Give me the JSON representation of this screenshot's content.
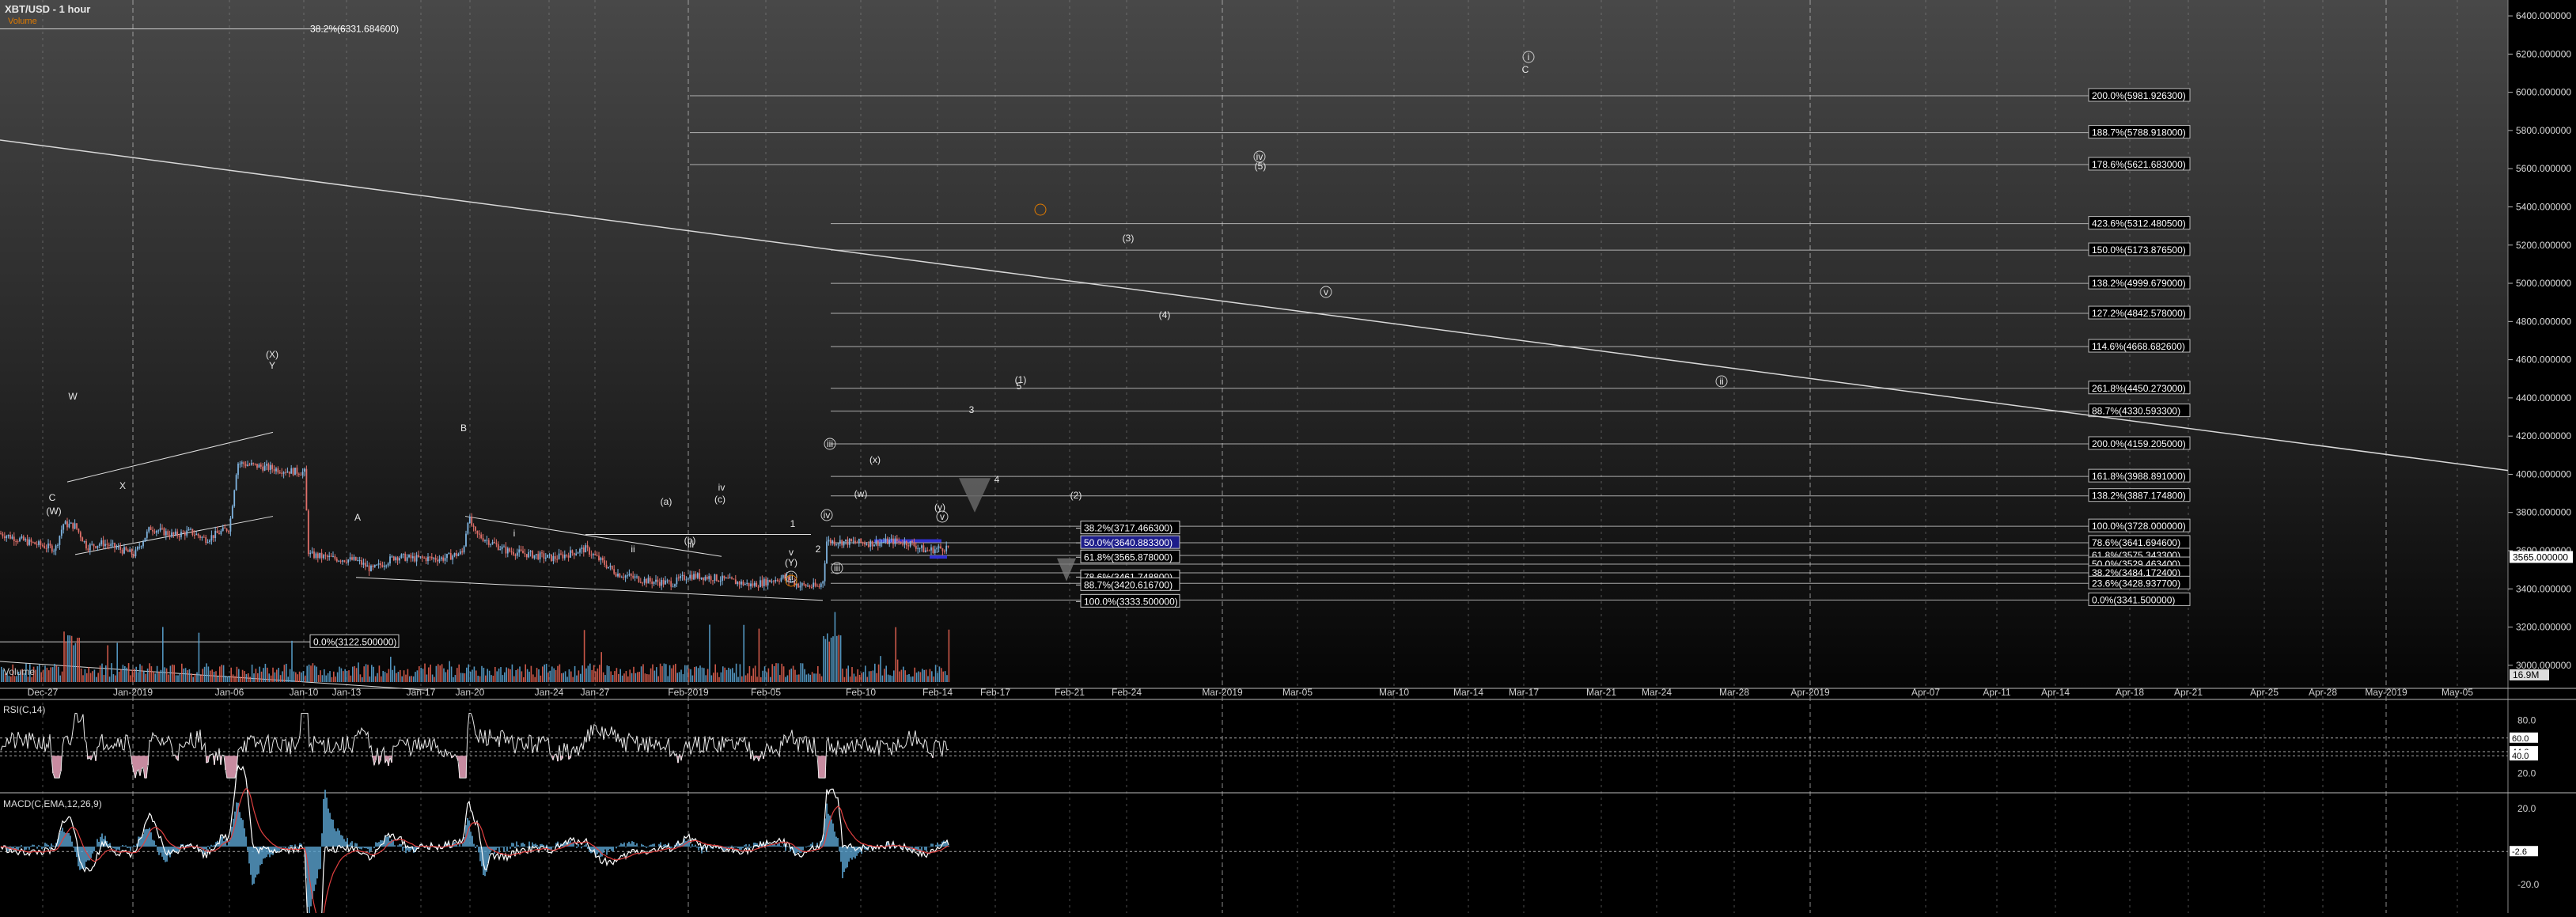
{
  "header": {
    "title": "XBT/USD - 1 hour",
    "volume_label": "Volume",
    "rsi_label": "RSI(C,14)",
    "macd_label": "MACD(C,EMA,12,26,9)",
    "volume_name": "Volume"
  },
  "colors": {
    "background": "#000000",
    "grid": "#cfcfcf",
    "candle_up": "#7fb4e0",
    "candle_down": "#e0706a",
    "fib_line": "#ffffff",
    "macd_line": "#ffffff",
    "macd_signal": "#e04040",
    "macd_hist": "#5aa3d0",
    "rsi_hist": "#c78ba0",
    "volume_up": "#5aa3d0",
    "volume_down": "#e06050",
    "orange": "#e07b00",
    "blue_box": "#3030d0"
  },
  "chart_data": {
    "type": "line",
    "title": "XBT/USD - 1 hour",
    "x_ticks": [
      "Dec-27",
      "Jan-2019",
      "Jan-06",
      "Jan-10",
      "Jan-13",
      "Jan-17",
      "Jan-20",
      "Jan-24",
      "Jan-27",
      "Feb-2019",
      "Feb-05",
      "Feb-10",
      "Feb-14",
      "Feb-17",
      "Feb-21",
      "Feb-24",
      "Mar-2019",
      "Mar-05",
      "Mar-10",
      "Mar-14",
      "Mar-17",
      "Mar-21",
      "Mar-24",
      "Mar-28",
      "Apr-2019",
      "Apr-07",
      "Apr-11",
      "Apr-14",
      "Apr-18",
      "Apr-21",
      "Apr-25",
      "Apr-28",
      "May-2019",
      "May-05"
    ],
    "y_ticks": [
      "6400.000000",
      "6200.000000",
      "6000.000000",
      "5800.000000",
      "5600.000000",
      "5400.000000",
      "5200.000000",
      "5000.000000",
      "4800.000000",
      "4600.000000",
      "4400.000000",
      "4200.000000",
      "4000.000000",
      "3800.000000",
      "3600.000000",
      "3400.000000",
      "3200.000000",
      "3000.000000"
    ],
    "y_range": [
      2900,
      6450
    ],
    "last_price_tag": "3565.000000",
    "volume_tag": "16.9M",
    "price_path": [
      [
        0,
        3690
      ],
      [
        40,
        3640
      ],
      [
        70,
        3610
      ],
      [
        80,
        3740
      ],
      [
        95,
        3730
      ],
      [
        110,
        3620
      ],
      [
        130,
        3640
      ],
      [
        170,
        3580
      ],
      [
        190,
        3720
      ],
      [
        220,
        3680
      ],
      [
        240,
        3700
      ],
      [
        260,
        3660
      ],
      [
        290,
        3720
      ],
      [
        300,
        4060
      ],
      [
        330,
        4040
      ],
      [
        360,
        4020
      ],
      [
        385,
        4010
      ],
      [
        390,
        3580
      ],
      [
        420,
        3560
      ],
      [
        450,
        3550
      ],
      [
        470,
        3500
      ],
      [
        500,
        3570
      ],
      [
        520,
        3560
      ],
      [
        560,
        3560
      ],
      [
        585,
        3590
      ],
      [
        592,
        3780
      ],
      [
        600,
        3690
      ],
      [
        640,
        3600
      ],
      [
        700,
        3560
      ],
      [
        740,
        3610
      ],
      [
        780,
        3480
      ],
      [
        820,
        3440
      ],
      [
        850,
        3430
      ],
      [
        870,
        3470
      ],
      [
        900,
        3460
      ],
      [
        950,
        3420
      ],
      [
        990,
        3460
      ],
      [
        1010,
        3420
      ],
      [
        1035,
        3410
      ],
      [
        1040,
        3440
      ],
      [
        1045,
        3650
      ],
      [
        1100,
        3640
      ],
      [
        1130,
        3650
      ],
      [
        1150,
        3640
      ],
      [
        1170,
        3600
      ],
      [
        1200,
        3620
      ]
    ],
    "fib_levels": [
      {
        "label": "38.2%(6331.684600)",
        "value": 6331.6846
      },
      {
        "label": "200.0%(5981.926300)",
        "value": 5981.9263
      },
      {
        "label": "188.7%(5788.918000)",
        "value": 5788.918
      },
      {
        "label": "178.6%(5621.683000)",
        "value": 5621.683
      },
      {
        "label": "423.6%(5312.480500)",
        "value": 5312.4805
      },
      {
        "label": "150.0%(5173.876500)",
        "value": 5173.8765
      },
      {
        "label": "138.2%(4999.679000)",
        "value": 4999.679
      },
      {
        "label": "127.2%(4842.578000)",
        "value": 4842.578
      },
      {
        "label": "114.6%(4668.682600)",
        "value": 4668.6826
      },
      {
        "label": "261.8%(4450.273000)",
        "value": 4450.273
      },
      {
        "label": "88.7%(4330.593300)",
        "value": 4330.5933
      },
      {
        "label": "200.0%(4159.205000)",
        "value": 4159.205
      },
      {
        "label": "161.8%(3988.891000)",
        "value": 3988.891
      },
      {
        "label": "138.2%(3887.174800)",
        "value": 3887.1748
      },
      {
        "label": "100.0%(3728.000000)",
        "value": 3728.0
      },
      {
        "label": "78.6%(3641.694600)",
        "value": 3641.6946
      },
      {
        "label": "61.8%(3575.343300)",
        "value": 3575.3433
      },
      {
        "label": "50.0%(3529.463400)",
        "value": 3529.4634
      },
      {
        "label": "38.2%(3484.172400)",
        "value": 3484.1724
      },
      {
        "label": "23.6%(3428.937700)",
        "value": 3428.9377
      },
      {
        "label": "0.0%(3341.500000)",
        "value": 3341.5
      },
      {
        "label": "0.0%(3122.500000)",
        "value": 3122.5
      }
    ],
    "fib_levels_mid": [
      {
        "label": "38.2%(3717.466300)",
        "value": 3717.4663
      },
      {
        "label": "50.0%(3640.883300)",
        "value": 3640.8833
      },
      {
        "label": "61.8%(3565.878000)",
        "value": 3565.878
      },
      {
        "label": "78.6%(3461.748800)",
        "value": 3461.7488
      },
      {
        "label": "88.7%(3420.616700)",
        "value": 3420.6167
      },
      {
        "label": "100.0%(3333.500000)",
        "value": 3333.5
      }
    ],
    "wave_labels": [
      "(X)",
      "Y",
      "W",
      "X",
      "C",
      "(W)",
      "A",
      "B",
      "i",
      "ii",
      "iii",
      "iv",
      "v",
      "(a)",
      "(b)",
      "(c)",
      "1",
      "2",
      "3",
      "4",
      "5",
      "(w)",
      "(x)",
      "(y)",
      "(1)",
      "(2)",
      "(3)",
      "(4)",
      "(5)",
      "i",
      "ii",
      "iii",
      "iv",
      "v",
      "C",
      "(Y)",
      "ii",
      "iii",
      "iv",
      "v"
    ],
    "rsi_ticks": [
      "80.0",
      "60.0",
      "40.0",
      "20.0"
    ],
    "rsi_tags": [
      "60.0",
      "44.6",
      "40.0"
    ],
    "macd_ticks": [
      "20.0",
      "-20.0",
      "-40.0"
    ],
    "macd_tag": "-2.6"
  }
}
